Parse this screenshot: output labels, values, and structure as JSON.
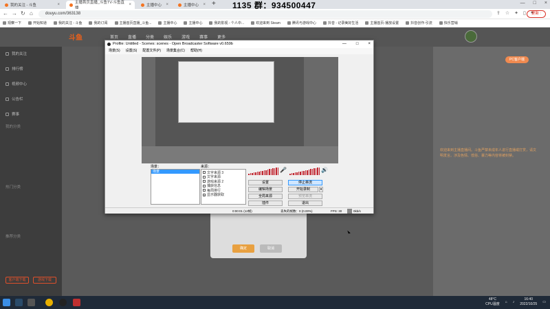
{
  "browser": {
    "tabs": [
      {
        "label": "我的关注 - 斗鱼"
      },
      {
        "label": "主播首页直播_斗鱼TV-斗鱼直播"
      },
      {
        "label": "主播中心"
      },
      {
        "label": "主播中心"
      }
    ],
    "url": "douyu.com/363138",
    "update_label": "更新 :",
    "overlay_text": "1135  群：934500447",
    "bookmarks": [
      "观察一下",
      "开始知道",
      "我的关注 - 斗鱼",
      "我的订阅",
      "主播首页直播_斗鱼...",
      "主播中心",
      "主播中心",
      "我的影视 - 个人中...",
      "欢迎来到 Steam",
      "腾讯与游戏中心",
      "抖音 - 记录美好生活",
      "主播首页-播放设置",
      "抖音创作-引流",
      "快乐营销"
    ]
  },
  "site": {
    "logo": "斗鱼",
    "nav": [
      "首页",
      "直播",
      "分类",
      "娱乐",
      "游戏",
      "赛事",
      "更多"
    ],
    "pc_button": "PC客户端",
    "sidebar_items": [
      "我的关注",
      "排行榜",
      "视频中心",
      "公告栏",
      "赛事"
    ],
    "sidebar_sections": [
      "我的分类",
      "热门分类",
      "推荐分类"
    ],
    "sidebar_btns": [
      "客户端下载",
      "游戏下载"
    ],
    "card_buttons": [
      "确定",
      "取消"
    ],
    "chat_text": "欢迎来到主播直播间。斗鱼严禁未成年人进行直播或打赏，请文明发言。涉及色情、低俗、暴力等内容将被封禁。"
  },
  "obs": {
    "title": "Profile: Untitled - Scenes: scenes - Open Broadcaster Software v0.659b",
    "menu": [
      "场景(S)",
      "设置(S)",
      "配置文件(P)",
      "场景集合(C)",
      "帮助(H)"
    ],
    "scenes_label": "场景：",
    "scenes": [
      "场景"
    ],
    "sources_label": "来源：",
    "sources": [
      {
        "label": "文字来源 3",
        "checked": false
      },
      {
        "label": "文字来源",
        "checked": false
      },
      {
        "label": "游戏来源 2",
        "checked": false
      },
      {
        "label": "捕获信息",
        "checked": false
      },
      {
        "label": "每周排行",
        "checked": false
      },
      {
        "label": "显示器获取",
        "checked": true
      }
    ],
    "buttons": {
      "settings": "设置",
      "stop_stream": "停止串流",
      "edit_scene": "编辑场景",
      "start_record": "开始录制",
      "global_sources": "全局来源",
      "preview": "预览串流",
      "plugins": "插件",
      "exit": "退出"
    },
    "status": {
      "time": "0:00:01 (12帧)",
      "dropped": "丢失的帧数：0 (0.00%)",
      "fps": "FPS: 30",
      "bitrate": "0kb/s"
    }
  },
  "taskbar": {
    "temp": "48°C",
    "cpu": "CPU温度",
    "time": "16:40",
    "date": "2022/10/25"
  }
}
